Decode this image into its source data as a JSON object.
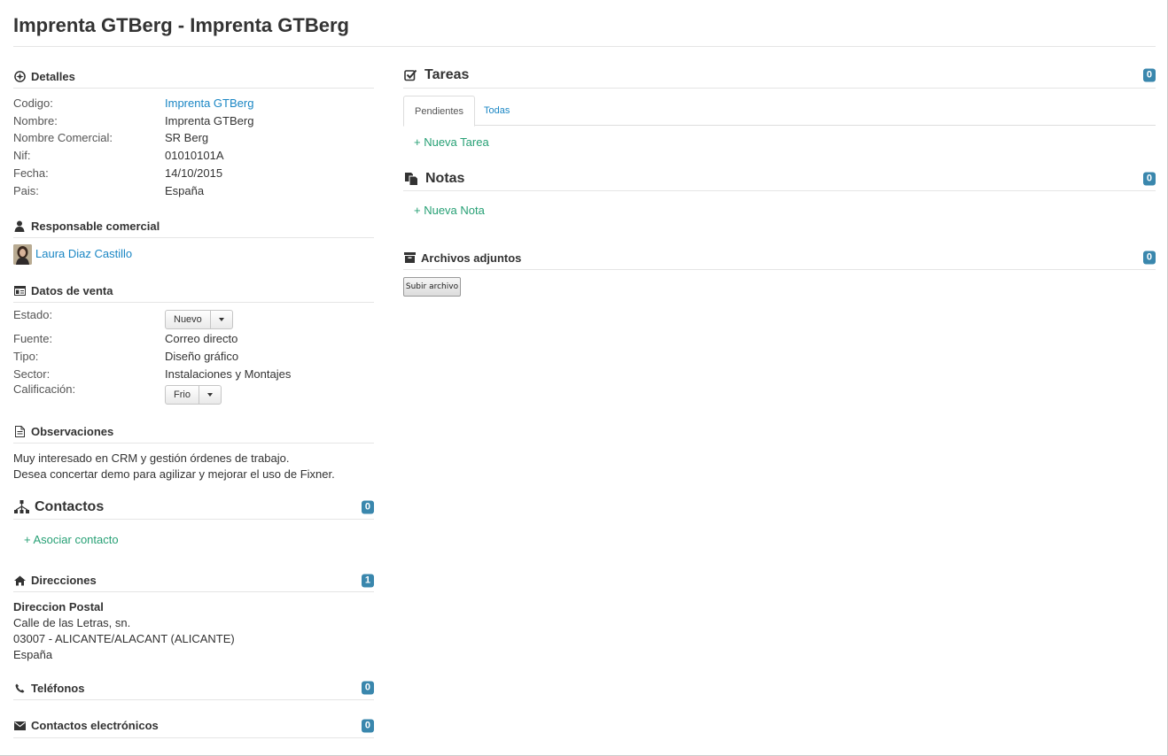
{
  "title": "Imprenta GTBerg - Imprenta GTBerg",
  "detalles": {
    "heading": "Detalles",
    "rows": [
      {
        "label": "Codigo:",
        "value": "Imprenta GTBerg"
      },
      {
        "label": "Nombre:",
        "value": "Imprenta GTBerg"
      },
      {
        "label": "Nombre Comercial:",
        "value": "SR Berg"
      },
      {
        "label": "Nif:",
        "value": "01010101A"
      },
      {
        "label": "Fecha:",
        "value": "14/10/2015"
      },
      {
        "label": "Pais:",
        "value": "España"
      }
    ]
  },
  "responsable": {
    "heading": "Responsable comercial",
    "name": "Laura Diaz Castillo"
  },
  "venta": {
    "heading": "Datos de venta",
    "estado_label": "Estado:",
    "estado_value": "Nuevo",
    "fuente_label": "Fuente:",
    "fuente_value": "Correo directo",
    "tipo_label": "Tipo:",
    "tipo_value": "Diseño gráfico",
    "sector_label": "Sector:",
    "sector_value": "Instalaciones y Montajes",
    "calificacion_label": "Calificación:",
    "calificacion_value": "Frio"
  },
  "observaciones": {
    "heading": "Observaciones",
    "line1": "Muy interesado en CRM y gestión órdenes de trabajo.",
    "line2": "Desea concertar demo para agilizar y mejorar el uso de Fixner."
  },
  "contactos": {
    "heading": "Contactos",
    "count": "0",
    "action": "+ Asociar contacto"
  },
  "direcciones": {
    "heading": "Direcciones",
    "count": "1",
    "type": "Direccion Postal",
    "line1": "Calle de las Letras, sn.",
    "line2": "03007 - ALICANTE/ALACANT (ALICANTE)",
    "line3": "España"
  },
  "telefonos": {
    "heading": "Teléfonos",
    "count": "0"
  },
  "electronicos": {
    "heading": "Contactos electrónicos",
    "count": "0"
  },
  "tareas": {
    "heading": "Tareas",
    "count": "0",
    "tab_pendientes": "Pendientes",
    "tab_todas": "Todas",
    "action": "+ Nueva Tarea"
  },
  "notas": {
    "heading": "Notas",
    "count": "0",
    "action": "+ Nueva Nota"
  },
  "adjuntos": {
    "heading": "Archivos adjuntos",
    "count": "0",
    "upload": "Subir archivo"
  },
  "colors": {
    "badge": "#3a87ad",
    "link": "#1a86c4",
    "action": "#27a075"
  }
}
